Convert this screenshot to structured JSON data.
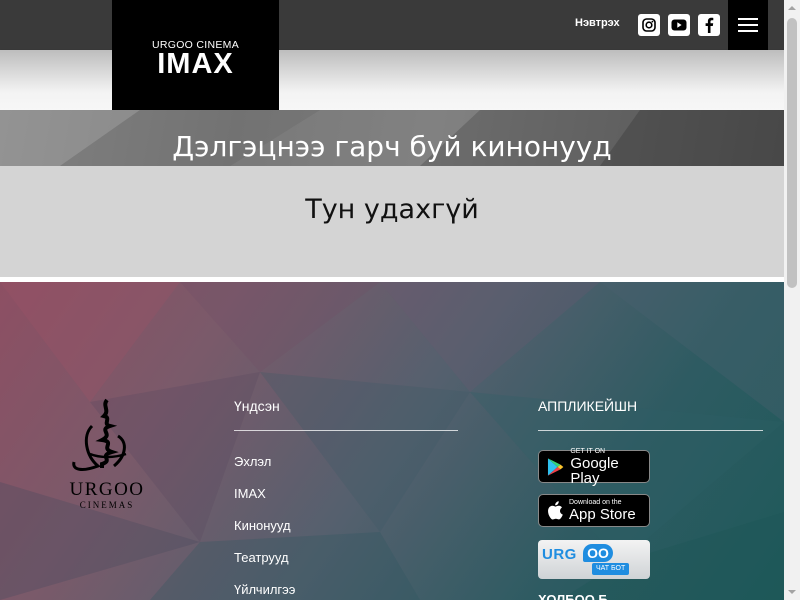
{
  "header": {
    "logo_small": "URGOO CINEMA",
    "logo_big": "IMAX",
    "login_label": "Нэвтрэх",
    "social_icons": [
      "instagram-icon",
      "youtube-icon",
      "facebook-icon"
    ],
    "menu_icon": "hamburger-menu-icon"
  },
  "hero": {
    "title": "Дэлгэцнээ гарч буй кинонууд"
  },
  "main": {
    "coming_soon": "Тун удахгүй"
  },
  "footer": {
    "brand_name": "URGOO",
    "brand_sub": "CINEMAS",
    "nav_title": "Үндсэн",
    "nav_items": [
      "Эхлэл",
      "IMAX",
      "Кинонууд",
      "Театрууд",
      "Үйлчилгээ"
    ],
    "apps_title": "АППЛИКЕЙШН",
    "google_play": {
      "small": "GET IT ON",
      "big": "Google Play"
    },
    "app_store": {
      "small": "Download on the",
      "big": "App Store"
    },
    "chatbot": {
      "logo_a": "URG",
      "logo_b": "OO",
      "sub": "ЧАТ БОТ"
    },
    "next_heading": "ХОЛБОО Б"
  },
  "colors": {
    "topbar": "#3a3a3a",
    "logo_bg": "#000000",
    "chat_blue": "#1f8de0"
  }
}
